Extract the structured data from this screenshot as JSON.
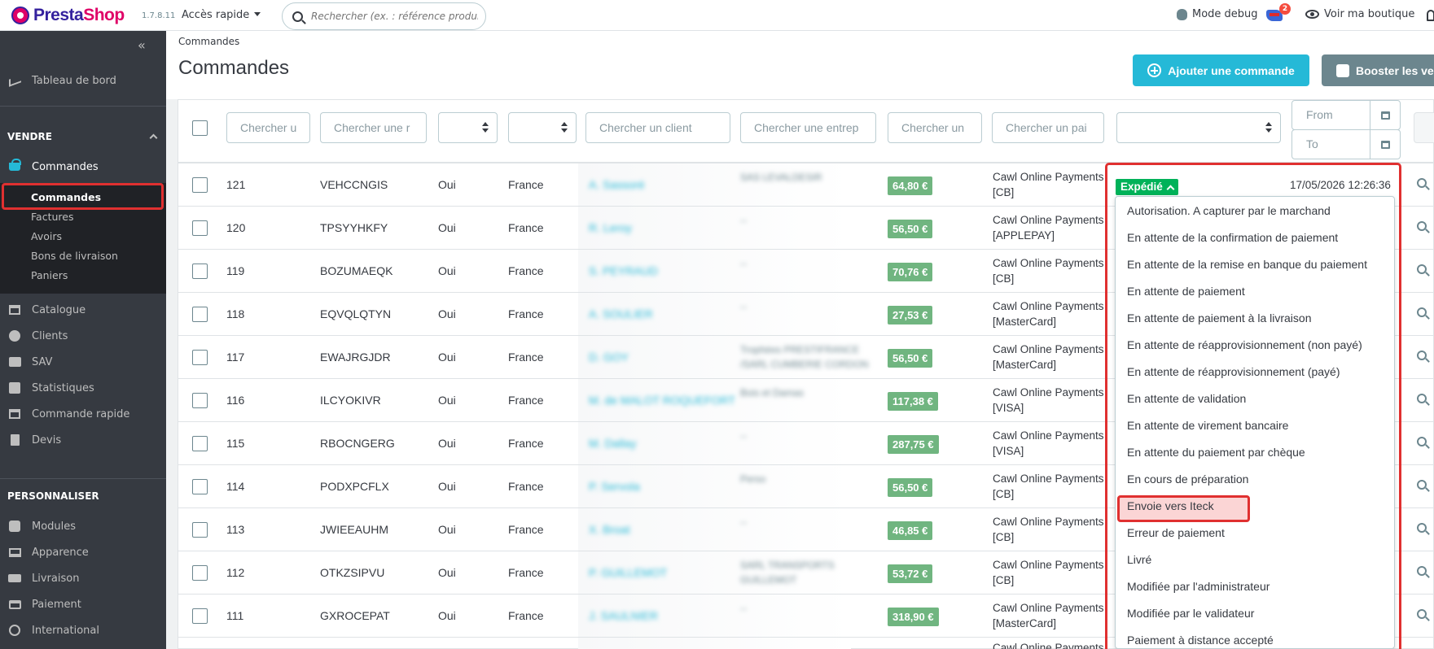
{
  "topbar": {
    "logo_main": "Presta",
    "logo_accent": "Shop",
    "version": "1.7.8.11",
    "quick_access": "Accès rapide",
    "search_placeholder": "Rechercher (ex. : référence produit, no",
    "debug": "Mode debug",
    "notif_count": "2",
    "view_shop": "Voir ma boutique"
  },
  "sidebar": {
    "dashboard": "Tableau de bord",
    "sell_title": "VENDRE",
    "orders": "Commandes",
    "sub": [
      "Commandes",
      "Factures",
      "Avoirs",
      "Bons de livraison",
      "Paniers"
    ],
    "catalog": "Catalogue",
    "clients": "Clients",
    "sav": "SAV",
    "stats": "Statistiques",
    "quick_order": "Commande rapide",
    "quotes": "Devis",
    "customize_title": "PERSONNALISER",
    "modules": "Modules",
    "appearance": "Apparence",
    "shipping": "Livraison",
    "payment": "Paiement",
    "international": "International"
  },
  "header": {
    "breadcrumb": "Commandes",
    "title": "Commandes",
    "add_button": "Ajouter une commande",
    "boost_button": "Booster les ventes"
  },
  "filters": {
    "ref": "Chercher u",
    "ref2": "Chercher une r",
    "client": "Chercher un client",
    "company": "Chercher une entrep",
    "total": "Chercher un",
    "payment": "Chercher un pai",
    "from": "From",
    "to": "To"
  },
  "rows": [
    {
      "id": "121",
      "ref": "VEHCCNGIS",
      "new": "Oui",
      "country": "France",
      "customer": "A. Sassoré",
      "company": "SAS LEVALDESIR",
      "total": "64,80 €",
      "payment": [
        "Cawl Online Payments",
        "[CB]"
      ]
    },
    {
      "id": "120",
      "ref": "TPSYYHKFY",
      "new": "Oui",
      "country": "France",
      "customer": "R. Leroy",
      "company": "--",
      "total": "56,50 €",
      "payment": [
        "Cawl Online Payments",
        "[APPLEPAY]"
      ]
    },
    {
      "id": "119",
      "ref": "BOZUMAEQK",
      "new": "Oui",
      "country": "France",
      "customer": "S. PEYRAUD",
      "company": "--",
      "total": "70,76 €",
      "payment": [
        "Cawl Online Payments",
        "[CB]"
      ]
    },
    {
      "id": "118",
      "ref": "EQVQLQTYN",
      "new": "Oui",
      "country": "France",
      "customer": "A. SOULIER",
      "company": "--",
      "total": "27,53 €",
      "payment": [
        "Cawl Online Payments",
        "[MasterCard]"
      ]
    },
    {
      "id": "117",
      "ref": "EWAJRGJDR",
      "new": "Oui",
      "country": "France",
      "customer": "D. GOY",
      "company": "Trophées PRESTIFRANCE /SARL CUMBERIE CORDON",
      "total": "56,50 €",
      "payment": [
        "Cawl Online Payments",
        "[MasterCard]"
      ]
    },
    {
      "id": "116",
      "ref": "ILCYOKIVR",
      "new": "Oui",
      "country": "France",
      "customer": "M. de MALOT ROQUEFORT",
      "company": "Bois et Damas",
      "total": "117,38 €",
      "payment": [
        "Cawl Online Payments",
        "[VISA]"
      ]
    },
    {
      "id": "115",
      "ref": "RBOCNGERG",
      "new": "Oui",
      "country": "France",
      "customer": "M. Dallay",
      "company": "--",
      "total": "287,75 €",
      "payment": [
        "Cawl Online Payments",
        "[VISA]"
      ]
    },
    {
      "id": "114",
      "ref": "PODXPCFLX",
      "new": "Oui",
      "country": "France",
      "customer": "P. Servola",
      "company": "Perso",
      "total": "56,50 €",
      "payment": [
        "Cawl Online Payments",
        "[CB]"
      ]
    },
    {
      "id": "113",
      "ref": "JWIEEAUHM",
      "new": "Oui",
      "country": "France",
      "customer": "X. Broat",
      "company": "--",
      "total": "46,85 €",
      "payment": [
        "Cawl Online Payments",
        "[CB]"
      ]
    },
    {
      "id": "112",
      "ref": "OTKZSIPVU",
      "new": "Oui",
      "country": "France",
      "customer": "P. GUILLEMOT",
      "company": "SARL TRANSPORTS GUILLEMOT",
      "total": "53,72 €",
      "payment": [
        "Cawl Online Payments",
        "[CB]"
      ]
    },
    {
      "id": "111",
      "ref": "GXROCEPAT",
      "new": "Oui",
      "country": "France",
      "customer": "J. SAULNIER",
      "company": "--",
      "total": "318,90 €",
      "payment": [
        "Cawl Online Payments",
        "[MasterCard]"
      ]
    }
  ],
  "last_row_payment": "Cawl Online Payments",
  "status": {
    "current": "Expédié",
    "date": "17/05/2026 12:26:36",
    "options": [
      "Autorisation. A capturer par le marchand",
      "En attente de la confirmation de paiement",
      "En attente de la remise en banque du paiement",
      "En attente de paiement",
      "En attente de paiement à la livraison",
      "En attente de réapprovisionnement (non payé)",
      "En attente de réapprovisionnement (payé)",
      "En attente de validation",
      "En attente de virement bancaire",
      "En attente du paiement par chèque",
      "En cours de préparation",
      "Envoie vers Iteck",
      "Erreur de paiement",
      "Livré",
      "Modifiée par l'administrateur",
      "Modifiée par le validateur",
      "Paiement à distance accepté"
    ]
  },
  "colors": {
    "accent": "#25b9d7",
    "sidebar": "#363a41",
    "status_green": "#00b259",
    "price_green": "#70b580",
    "highlight_red": "#e03030"
  }
}
